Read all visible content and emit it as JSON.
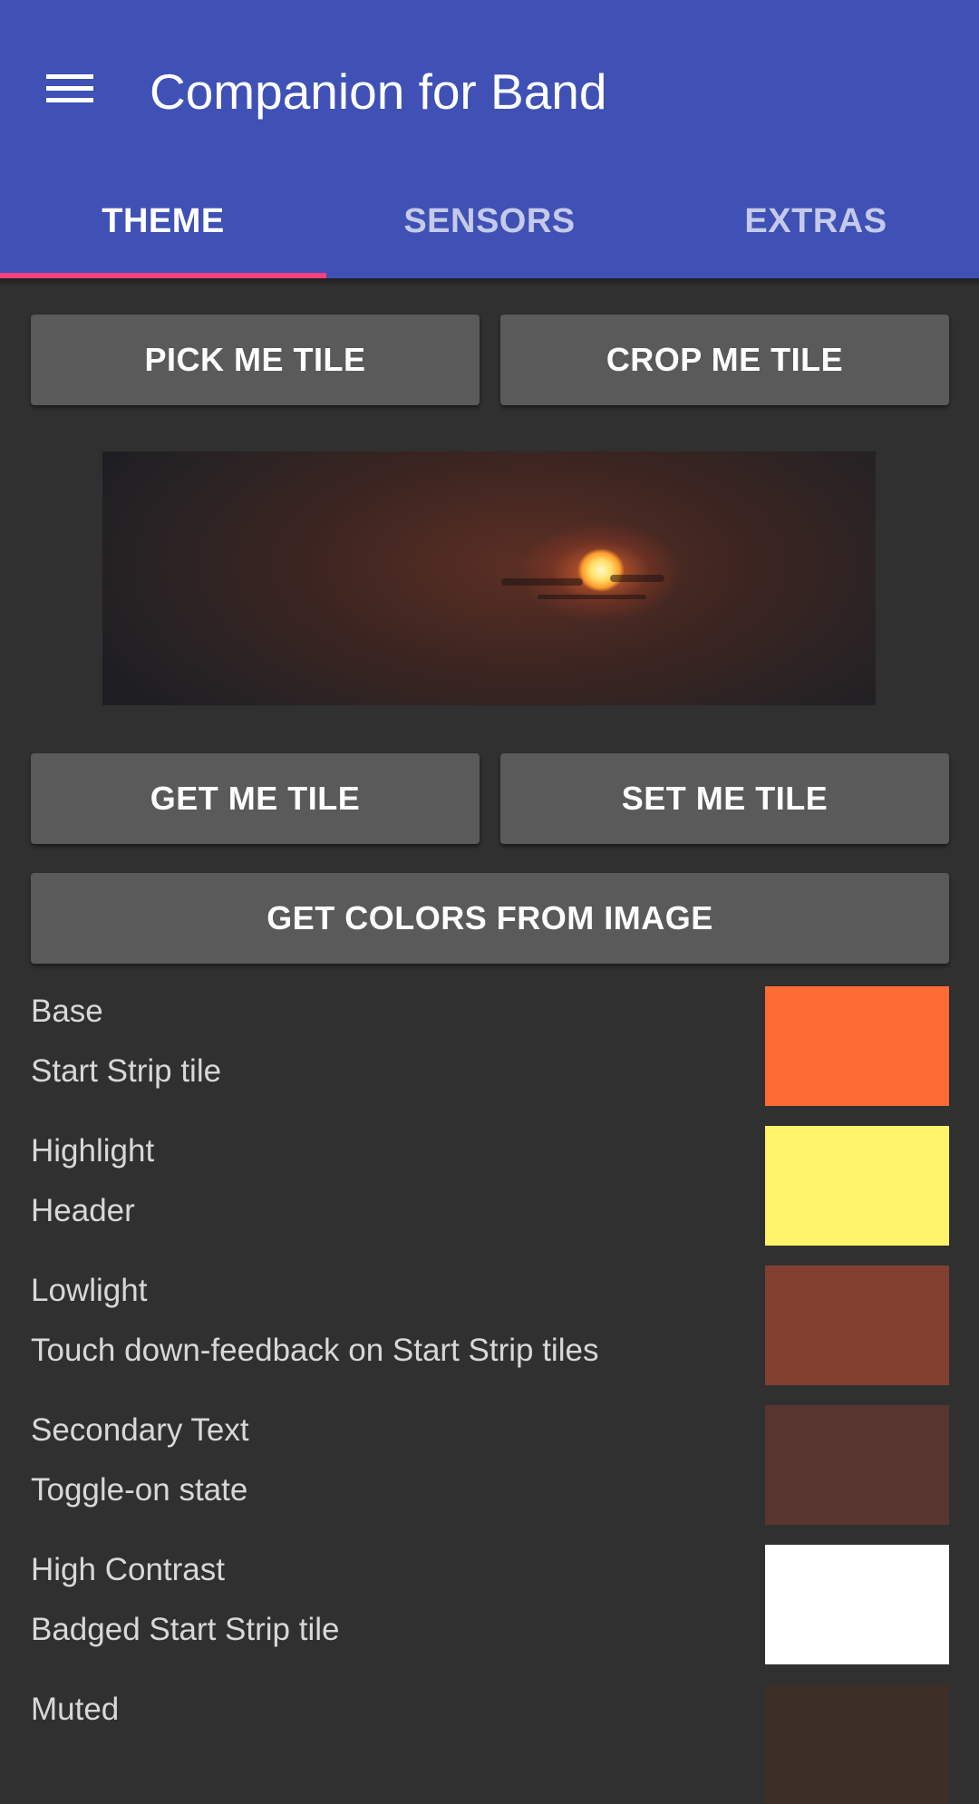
{
  "app": {
    "title": "Companion for Band",
    "menu_icon": "hamburger-menu-icon"
  },
  "tabs": [
    {
      "label": "THEME",
      "active": true
    },
    {
      "label": "SENSORS",
      "active": false
    },
    {
      "label": "EXTRAS",
      "active": false
    }
  ],
  "buttons": {
    "pick": "PICK ME TILE",
    "crop": "CROP ME TILE",
    "get": "GET ME TILE",
    "set": "SET ME TILE",
    "colors": "GET COLORS FROM IMAGE"
  },
  "colors": {
    "primary": "#3F51B5",
    "accent": "#FF4081",
    "background": "#303030",
    "button": "#5A5A5A"
  },
  "swatches": [
    {
      "title": "Base",
      "subtitle": "Start Strip tile",
      "color": "#FF6B35"
    },
    {
      "title": "Highlight",
      "subtitle": "Header",
      "color": "#FFF36A"
    },
    {
      "title": "Lowlight",
      "subtitle": "Touch down-feedback on Start Strip tiles",
      "color": "#823F30"
    },
    {
      "title": "Secondary Text",
      "subtitle": "Toggle-on state",
      "color": "#58362F"
    },
    {
      "title": "High Contrast",
      "subtitle": "Badged Start Strip tile",
      "color": "#FFFFFF"
    },
    {
      "title": "Muted",
      "subtitle": "",
      "color": "#3D2E28"
    }
  ]
}
